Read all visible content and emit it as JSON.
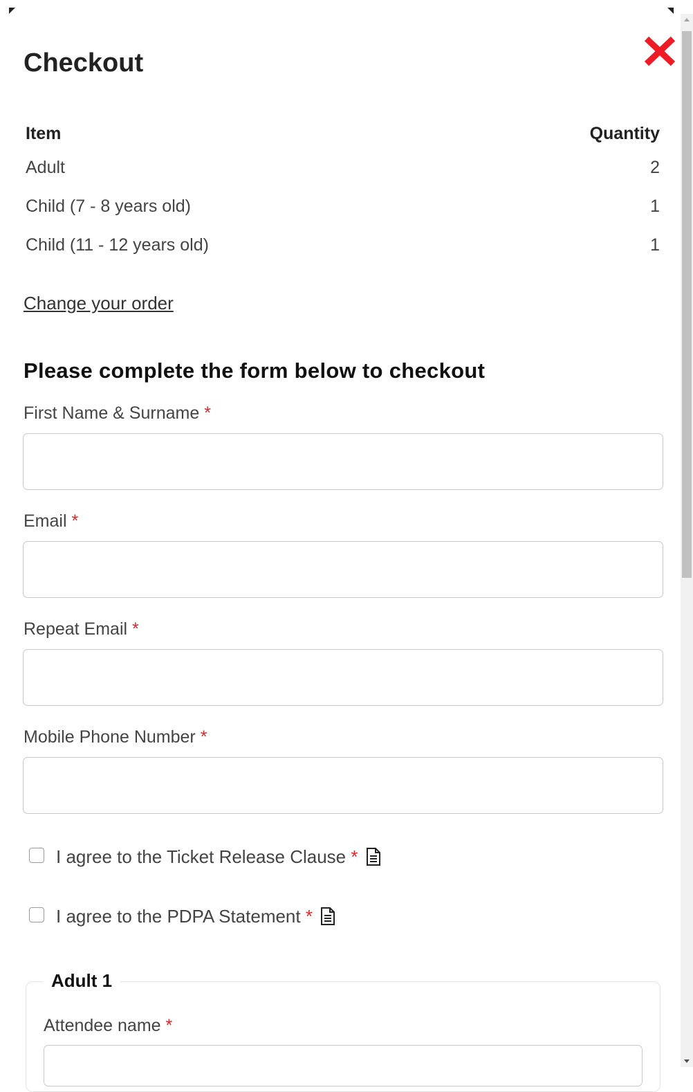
{
  "modal": {
    "title": "Checkout",
    "close_label": "close",
    "accent_color": "#ee1c25"
  },
  "order": {
    "columns": {
      "item": "Item",
      "quantity": "Quantity"
    },
    "rows": [
      {
        "item": "Adult",
        "quantity": "2"
      },
      {
        "item": "Child (7 - 8 years old)",
        "quantity": "1"
      },
      {
        "item": "Child (11 - 12 years old)",
        "quantity": "1"
      }
    ],
    "change_link": "Change your order"
  },
  "form": {
    "heading": "Please complete the form below to checkout",
    "required_marker": "*",
    "fields": {
      "name": {
        "label": "First Name & Surname",
        "value": ""
      },
      "email": {
        "label": "Email",
        "value": ""
      },
      "repeat_email": {
        "label": "Repeat Email",
        "value": ""
      },
      "phone": {
        "label": "Mobile Phone Number",
        "value": ""
      }
    },
    "checkboxes": {
      "ticket_release": {
        "label": "I agree to the Ticket Release Clause",
        "checked": false
      },
      "pdpa": {
        "label": "I agree to the PDPA Statement",
        "checked": false
      }
    }
  },
  "attendees": [
    {
      "legend": "Adult 1",
      "name_label": "Attendee name",
      "name_value": ""
    }
  ]
}
